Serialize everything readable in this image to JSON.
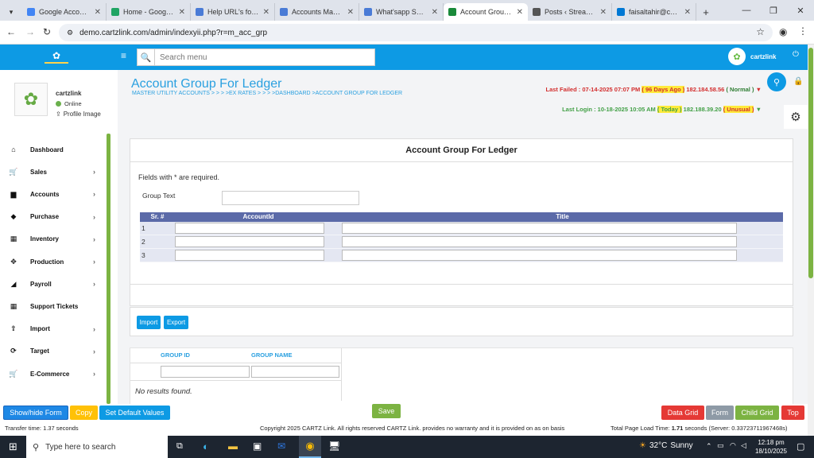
{
  "browser": {
    "tabs": [
      {
        "title": "Google Accounts",
        "color": "#4285f4",
        "active": false
      },
      {
        "title": "Home - Google Drive",
        "color": "#1fa463",
        "active": false
      },
      {
        "title": "Help URL's for ERP",
        "color": "#4a7bd6",
        "active": false
      },
      {
        "title": "Accounts Master Li",
        "color": "#4a7bd6",
        "active": false
      },
      {
        "title": "What'sapp Sales M",
        "color": "#4a7bd6",
        "active": false
      },
      {
        "title": "Account Group For L",
        "color": "#1a8a3a",
        "active": true
      },
      {
        "title": "Posts ‹ Streamline",
        "color": "#555",
        "active": false
      },
      {
        "title": "faisaltahir@cartzli",
        "color": "#0078d4",
        "active": false
      }
    ],
    "url": "demo.cartzlink.com/admin/indexyii.php?r=m_acc_grp"
  },
  "header": {
    "search_placeholder": "Search menu",
    "user_name": "cartzlink"
  },
  "profile": {
    "name": "cartzlink",
    "status": "Online",
    "profile_image_label": "Profile Image"
  },
  "sidebar": {
    "items": [
      {
        "label": "Dashboard",
        "icon": "home-icon",
        "glyph": "⌂",
        "chevron": false
      },
      {
        "label": "Sales",
        "icon": "cart-icon",
        "glyph": "🛒",
        "chevron": true
      },
      {
        "label": "Accounts",
        "icon": "bank-icon",
        "glyph": "▆",
        "chevron": true
      },
      {
        "label": "Purchase",
        "icon": "tag-icon",
        "glyph": "◆",
        "chevron": true
      },
      {
        "label": "Inventory",
        "icon": "grid-icon",
        "glyph": "▦",
        "chevron": true
      },
      {
        "label": "Production",
        "icon": "move-icon",
        "glyph": "✥",
        "chevron": true
      },
      {
        "label": "Payroll",
        "icon": "bullhorn-icon",
        "glyph": "◢",
        "chevron": true
      },
      {
        "label": "Support Tickets",
        "icon": "grid-icon",
        "glyph": "▦",
        "chevron": false
      },
      {
        "label": "Import",
        "icon": "upload-icon",
        "glyph": "⇪",
        "chevron": true
      },
      {
        "label": "Target",
        "icon": "refresh-icon",
        "glyph": "⟳",
        "chevron": true
      },
      {
        "label": "E-Commerce",
        "icon": "cart-icon",
        "glyph": "🛒",
        "chevron": true
      }
    ]
  },
  "page": {
    "title": "Account Group For Ledger",
    "breadcrumb": "MASTER UTILITY ACCOUNTS > > > >EX RATES > > > >DASHBOARD >ACCOUNT GROUP FOR LEDGER",
    "last_failed_prefix": "Last Failed : 07-14-2025 07:07 PM",
    "last_failed_days": "( 96 Days Ago )",
    "last_failed_ip": "182.184.58.56",
    "last_failed_status": "( Normal )",
    "last_login_prefix": "Last Login : 10-18-2025 10:05 AM",
    "last_login_days": "( Today )",
    "last_login_ip": "182.188.39.20",
    "last_login_status": "( Unusual )"
  },
  "form": {
    "title": "Account Group For Ledger",
    "required_note": "Fields with * are required.",
    "group_text_label": "Group Text",
    "group_text_value": "",
    "columns": [
      "Sr. #",
      "AccountId",
      "Title"
    ],
    "rows": [
      "1",
      "2",
      "3"
    ],
    "import_label": "Import",
    "export_label": "Export"
  },
  "results": {
    "columns": [
      "GROUP ID",
      "GROUP NAME"
    ],
    "empty_text": "No results found."
  },
  "toolbar": {
    "show_hide_label": "Show/hide Form",
    "copy_label": "Copy",
    "set_default_label": "Set Default Values",
    "save_label": "Save",
    "data_grid_label": "Data Grid",
    "form_label": "Form",
    "child_grid_label": "Child Grid",
    "top_label": "Top"
  },
  "footer": {
    "transfer_time": "Transfer time: 1.37 seconds",
    "copyright": "Copyright 2025 CARTZ Link. All rights reserved CARTZ Link. provides no warranty and it is provided on as on basis",
    "load_time_prefix": "Total Page Load Time:",
    "load_time_value": "1.71",
    "load_time_suffix": "seconds (Server: 0.33723711967468s)"
  },
  "taskbar": {
    "search_placeholder": "Type here to search",
    "weather_temp": "32°C",
    "weather_desc": "Sunny",
    "time": "12:18 pm",
    "date": "18/10/2025"
  },
  "colors": {
    "brand": "#0d9ae4",
    "title_blue": "#2aa0e0",
    "table_header": "#5b6aa8",
    "save_green": "#7cb342",
    "red": "#e53935",
    "gray": "#8e9aa6"
  }
}
